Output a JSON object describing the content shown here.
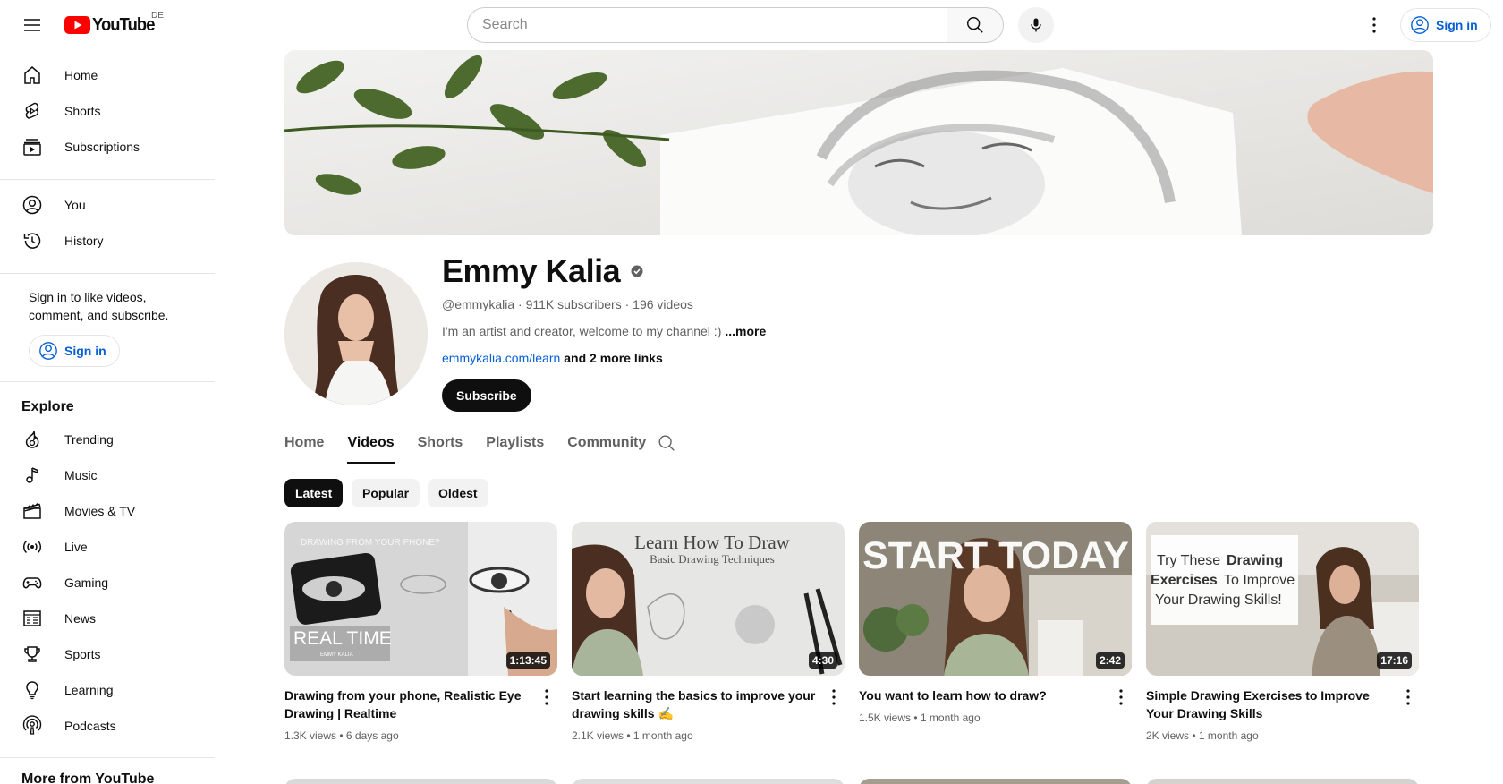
{
  "header": {
    "logo_text": "YouTube",
    "country": "DE",
    "search_placeholder": "Search",
    "signin_label": "Sign in"
  },
  "sidebar": {
    "main": [
      {
        "label": "Home",
        "icon": "home-icon"
      },
      {
        "label": "Shorts",
        "icon": "shorts-icon"
      },
      {
        "label": "Subscriptions",
        "icon": "subscriptions-icon"
      }
    ],
    "you": [
      {
        "label": "You",
        "icon": "you-icon"
      },
      {
        "label": "History",
        "icon": "history-icon"
      }
    ],
    "signin_text": "Sign in to like videos, comment, and subscribe.",
    "signin_label": "Sign in",
    "explore_heading": "Explore",
    "explore": [
      {
        "label": "Trending",
        "icon": "trending-icon"
      },
      {
        "label": "Music",
        "icon": "music-icon"
      },
      {
        "label": "Movies & TV",
        "icon": "movies-icon"
      },
      {
        "label": "Live",
        "icon": "live-icon"
      },
      {
        "label": "Gaming",
        "icon": "gaming-icon"
      },
      {
        "label": "News",
        "icon": "news-icon"
      },
      {
        "label": "Sports",
        "icon": "sports-icon"
      },
      {
        "label": "Learning",
        "icon": "learning-icon"
      },
      {
        "label": "Podcasts",
        "icon": "podcasts-icon"
      }
    ],
    "more_heading": "More from YouTube"
  },
  "channel": {
    "name": "Emmy Kalia",
    "handle": "@emmykalia",
    "subscribers": "911K subscribers",
    "videos_count": "196 videos",
    "description": "I'm an artist and creator, welcome to my channel :)",
    "more_label": "...more",
    "link": "emmykalia.com/learn",
    "more_links": "and 2 more links",
    "subscribe_label": "Subscribe"
  },
  "tabs": [
    "Home",
    "Videos",
    "Shorts",
    "Playlists",
    "Community"
  ],
  "active_tab": "Videos",
  "chips": [
    "Latest",
    "Popular",
    "Oldest"
  ],
  "active_chip": "Latest",
  "videos": [
    {
      "title": "Drawing from your phone, Realistic Eye Drawing | Realtime",
      "views": "1.3K views",
      "age": "6 days ago",
      "duration": "1:13:45",
      "thumb_text": "REAL TIME",
      "thumb_subtext": "EMMY KALIA",
      "thumb_top": "DRAWING FROM YOUR PHONE?"
    },
    {
      "title": "Start learning the basics to improve your drawing skills ✍️",
      "views": "2.1K views",
      "age": "1 month ago",
      "duration": "4:30",
      "thumb_text": "Learn How To Draw",
      "thumb_subtext": "Basic Drawing Techniques"
    },
    {
      "title": "You want to learn how to draw?",
      "views": "1.5K views",
      "age": "1 month ago",
      "duration": "2:42",
      "thumb_text": "START TODAY"
    },
    {
      "title": "Simple Drawing Exercises to Improve Your Drawing Skills",
      "views": "2K views",
      "age": "1 month ago",
      "duration": "17:16",
      "thumb_text_1": "Try These",
      "thumb_text_2": "Drawing",
      "thumb_text_3": "Exercises",
      "thumb_text_4": "To Improve",
      "thumb_text_5": "Your Drawing Skills!"
    }
  ],
  "colors": {
    "brand_red": "#ff0000",
    "link_blue": "#065fd4",
    "text": "#0f0f0f",
    "secondary": "#606060"
  }
}
